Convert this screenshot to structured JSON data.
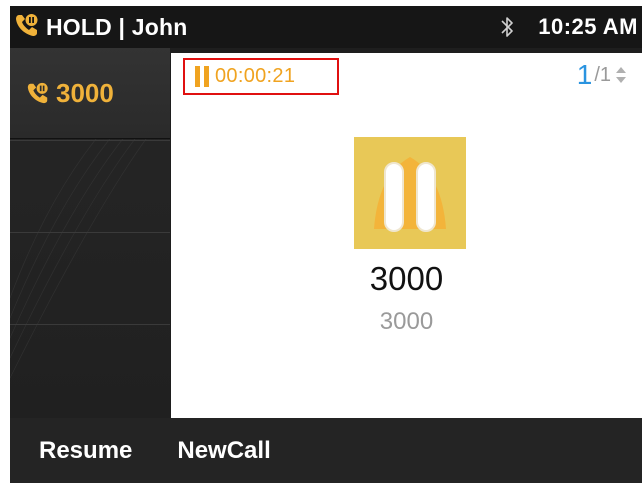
{
  "status_bar": {
    "title": "HOLD | John",
    "time": "10:25 AM",
    "icons": [
      "hold-call-icon",
      "bluetooth-icon"
    ]
  },
  "lines": [
    {
      "label": "3000",
      "icon": "hold-call-icon",
      "active": true
    },
    {
      "label": ""
    },
    {
      "label": ""
    },
    {
      "label": ""
    }
  ],
  "call": {
    "timer": "00:00:21",
    "page_current": "1",
    "page_total": "/1",
    "contact_name": "3000",
    "contact_number": "3000",
    "avatar_icon": "hold-pause-icon"
  },
  "softkeys": {
    "resume_label": "Resume",
    "newcall_label": "NewCall"
  },
  "colors": {
    "accent": "#f0a320",
    "avatar_bg": "#e8c857",
    "page_current": "#2a94e0",
    "highlight_border": "#e01010"
  }
}
